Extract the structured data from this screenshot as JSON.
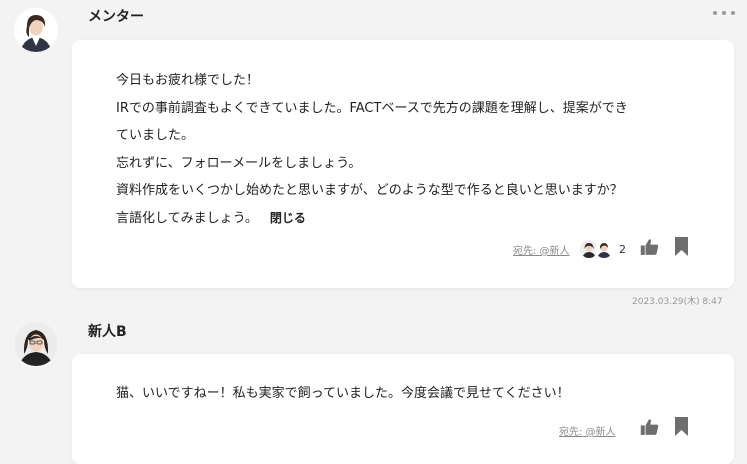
{
  "posts": [
    {
      "author": "メンター",
      "lines": [
        "今日もお疲れ様でした！",
        "IRでの事前調査もよくできていました。FACTベースで先方の課題を理解し、提案ができ",
        "ていました。",
        "忘れずに、フォローメールをしましょう。",
        "資料作成をいくつかし始めたと思いますが、どのような型で作ると良いと思いますか？",
        "言語化してみましょう。"
      ],
      "close_label": "閉じる",
      "recipient": "宛先: @新人",
      "reaction_count": "2",
      "timestamp": "2023.03.29(木) 8:47"
    },
    {
      "author": "新人B",
      "lines": [
        "猫、いいですねー！私も実家で飼っていました。今度会議で見せてください！"
      ],
      "recipient": "宛先: @新人"
    }
  ],
  "icons": [
    "more-options-icon",
    "thumbs-up-icon",
    "bookmark-icon"
  ],
  "colors": {
    "background": "#f3f3f3",
    "card": "#ffffff",
    "icon": "#6e6e6e",
    "muted_text": "#8a8a8a"
  }
}
